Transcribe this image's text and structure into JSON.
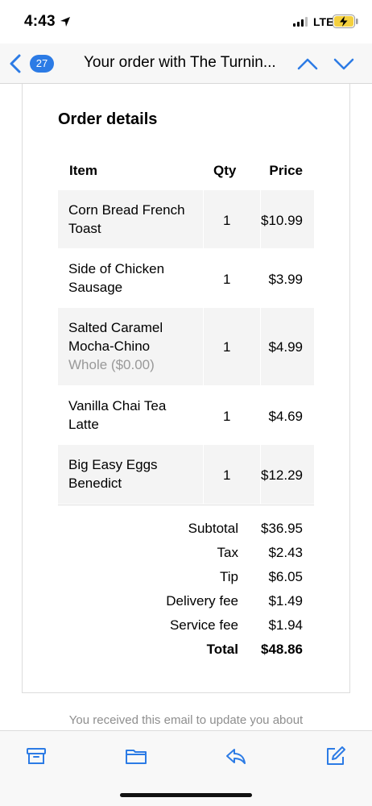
{
  "status_bar": {
    "time": "4:43",
    "network": "LTE"
  },
  "nav": {
    "unread_count": "27",
    "title": "Your order with The Turnin..."
  },
  "order": {
    "title": "Order details",
    "columns": {
      "item": "Item",
      "qty": "Qty",
      "price": "Price"
    },
    "rows": [
      {
        "name": "Corn Bread French Toast",
        "modifier": "",
        "qty": "1",
        "price": "$10.99"
      },
      {
        "name": "Side of Chicken Sausage",
        "modifier": "",
        "qty": "1",
        "price": "$3.99"
      },
      {
        "name": "Salted Caramel Mocha-Chino",
        "modifier": "Whole ($0.00)",
        "qty": "1",
        "price": "$4.99"
      },
      {
        "name": "Vanilla Chai Tea Latte",
        "modifier": "",
        "qty": "1",
        "price": "$4.69"
      },
      {
        "name": "Big Easy Eggs Benedict",
        "modifier": "",
        "qty": "1",
        "price": "$12.29"
      }
    ],
    "totals": [
      {
        "label": "Subtotal",
        "value": "$36.95"
      },
      {
        "label": "Tax",
        "value": "$2.43"
      },
      {
        "label": "Tip",
        "value": "$6.05"
      },
      {
        "label": "Delivery fee",
        "value": "$1.49"
      },
      {
        "label": "Service fee",
        "value": "$1.94"
      },
      {
        "label": "Total",
        "value": "$48.86"
      }
    ]
  },
  "footer_note": "You received this email to update you about",
  "toolbar": {
    "icons": [
      "archive-icon",
      "folder-icon",
      "reply-icon",
      "compose-icon"
    ]
  },
  "colors": {
    "accent": "#2c7be5",
    "row_shade": "#f4f4f4",
    "muted_text": "#999999"
  }
}
